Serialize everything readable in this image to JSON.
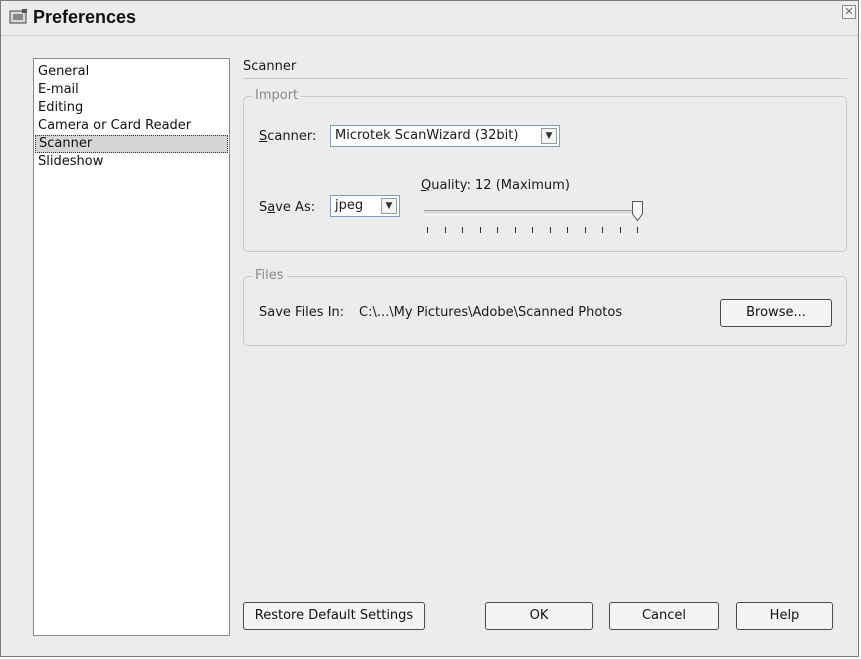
{
  "window": {
    "title": "Preferences"
  },
  "sidebar": {
    "items": [
      {
        "label": "General"
      },
      {
        "label": "E-mail"
      },
      {
        "label": "Editing"
      },
      {
        "label": "Camera or Card Reader"
      },
      {
        "label": "Scanner",
        "selected": true
      },
      {
        "label": "Slideshow"
      }
    ]
  },
  "content": {
    "section_title": "Scanner",
    "import": {
      "legend": "Import",
      "scanner_label": "Scanner:",
      "scanner_value": "Microtek ScanWizard (32bit)",
      "save_as_label": "Save As:",
      "save_as_value": "jpeg",
      "quality_label": "Quality: 12 (Maximum)",
      "quality_value": 12,
      "quality_max": 12
    },
    "files": {
      "legend": "Files",
      "save_files_label": "Save Files In:",
      "save_files_path": "C:\\...\\My Pictures\\Adobe\\Scanned Photos",
      "browse_label": "Browse..."
    }
  },
  "footer": {
    "restore_label": "Restore Default Settings",
    "ok_label": "OK",
    "cancel_label": "Cancel",
    "help_label": "Help"
  },
  "colors": {
    "window_bg": "#ececec",
    "selection_bg": "#d6d6d6"
  }
}
